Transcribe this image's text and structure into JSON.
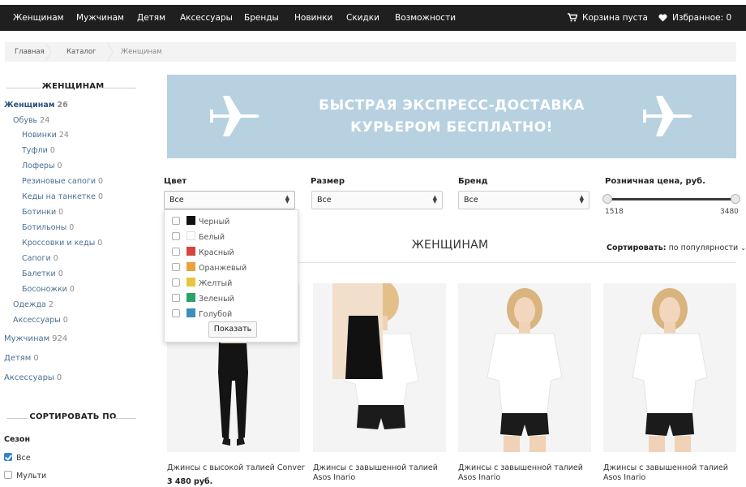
{
  "nav": {
    "items": [
      "Женщинам",
      "Мужчинам",
      "Детям",
      "Аксессуары",
      "Бренды",
      "Новинки",
      "Скидки",
      "Возможности"
    ],
    "cart_label": "Корзина пуста",
    "favorites_label": "Избранное: 0",
    "cart_icon": "cart-icon",
    "favorites_icon": "heart-icon"
  },
  "breadcrumb": [
    "Главная",
    "Каталог",
    "Женщинам"
  ],
  "sidebar": {
    "heading": "ЖЕНЩИНАМ",
    "categories": [
      {
        "label": "Женщинам",
        "count": "26"
      },
      {
        "label": "Обувь",
        "count": "24"
      },
      {
        "label": "Новинки",
        "count": "24"
      },
      {
        "label": "Туфли",
        "count": "0"
      },
      {
        "label": "Лоферы",
        "count": "0"
      },
      {
        "label": "Резиновые сапоги",
        "count": "0"
      },
      {
        "label": "Кеды на танкетке",
        "count": "0"
      },
      {
        "label": "Ботинки",
        "count": "0"
      },
      {
        "label": "Ботильоны",
        "count": "0"
      },
      {
        "label": "Кроссовки и кеды",
        "count": "0"
      },
      {
        "label": "Сапоги",
        "count": "0"
      },
      {
        "label": "Балетки",
        "count": "0"
      },
      {
        "label": "Босоножки",
        "count": "0"
      },
      {
        "label": "Одежда",
        "count": "2"
      },
      {
        "label": "Аксессуары",
        "count": "0"
      },
      {
        "label": "Мужчинам",
        "count": "924"
      },
      {
        "label": "Детям",
        "count": "0"
      },
      {
        "label": "Аксессуары",
        "count": "0"
      }
    ],
    "sort_heading": "СОРТИРОВАТЬ ПО",
    "season_label": "Сезон",
    "season_options": [
      {
        "label": "Все",
        "checked": true
      },
      {
        "label": "Мульти",
        "checked": false
      }
    ]
  },
  "banner": {
    "line1": "БЫСТРАЯ ЭКСПРЕСС-ДОСТАВКА",
    "line2": "КУРЬЕРОМ БЕСПЛАТНО!",
    "icon": "airplane-icon",
    "background": "#b7d1e1"
  },
  "filters": {
    "color_label": "Цвет",
    "color_value": "Все",
    "size_label": "Размер",
    "size_value": "Все",
    "brand_label": "Бренд",
    "brand_value": "Все",
    "price_label": "Розничная цена, руб.",
    "price_min": "1518",
    "price_max": "3480"
  },
  "color_dropdown": {
    "options": [
      {
        "label": "Черный",
        "color": "#111111"
      },
      {
        "label": "Белый",
        "color": "#ffffff"
      },
      {
        "label": "Красный",
        "color": "#d64541"
      },
      {
        "label": "Оранжевый",
        "color": "#e8a33c"
      },
      {
        "label": "Желтый",
        "color": "#e9c53d"
      },
      {
        "label": "Зеленый",
        "color": "#2aa36b"
      },
      {
        "label": "Голубой",
        "color": "#3b8fbf"
      }
    ],
    "button_label": "Показать"
  },
  "listing": {
    "title": "ЖЕНЩИНАМ",
    "sort_label": "Сортировать:",
    "sort_value": "по популярности"
  },
  "products": [
    {
      "name": "Джинсы с высокой талией Conver",
      "price": "3 480 руб."
    },
    {
      "name": "Джинсы с завышенной талией Asos Inario",
      "price": ""
    },
    {
      "name": "Джинсы с завышенной талией Asos Inario",
      "price": ""
    },
    {
      "name": "Джинсы с завышенной талией Asos Inario",
      "price": ""
    }
  ]
}
